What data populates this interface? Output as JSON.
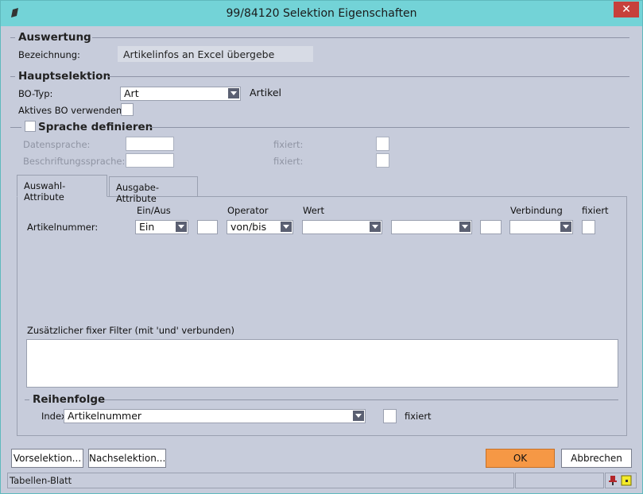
{
  "window": {
    "title": "99/84120 Selektion Eigenschaften",
    "close_glyph": "✕"
  },
  "auswertung": {
    "heading": "Auswertung",
    "bezeichnung_label": "Bezeichnung:",
    "bezeichnung_value": "Artikelinfos an Excel übergebe"
  },
  "hauptselektion": {
    "heading": "Hauptselektion",
    "bo_typ_label": "BO-Typ:",
    "bo_typ_value": "Art",
    "bo_typ_desc": "Artikel",
    "aktives_bo_label": "Aktives BO verwenden:"
  },
  "sprache": {
    "heading": "Sprache definieren",
    "datensprache_label": "Datensprache:",
    "beschriftung_label": "Beschriftungssprache:",
    "fixiert1_label": "fixiert:",
    "fixiert2_label": "fixiert:"
  },
  "tabs": [
    {
      "label": "Auswahl-Attribute",
      "active": true
    },
    {
      "label": "Ausgabe-Attribute",
      "active": false
    }
  ],
  "attr_table": {
    "headers": {
      "ein_aus": "Ein/Aus",
      "operator": "Operator",
      "wert": "Wert",
      "verbindung": "Verbindung",
      "fixiert": "fixiert"
    },
    "row": {
      "label": "Artikelnummer:",
      "ein_aus": "Ein",
      "operator": "von/bis",
      "wert1": "",
      "wert2": "",
      "verbindung": ""
    }
  },
  "filter": {
    "label": "Zusätzlicher fixer Filter (mit 'und' verbunden)"
  },
  "reihenfolge": {
    "heading": "Reihenfolge",
    "index_label": "Index:",
    "index_value": "Artikelnummer",
    "fixiert_label": "fixiert"
  },
  "buttons": {
    "vorselektion": "Vorselektion...",
    "nachselektion": "Nachselektion...",
    "ok": "OK",
    "abbrechen": "Abbrechen"
  },
  "status": {
    "text": "Tabellen-Blatt"
  },
  "colors": {
    "window_bg": "#c7ccdb",
    "titlebar": "#73d3d7",
    "close": "#c7403b",
    "ok": "#f69845"
  }
}
